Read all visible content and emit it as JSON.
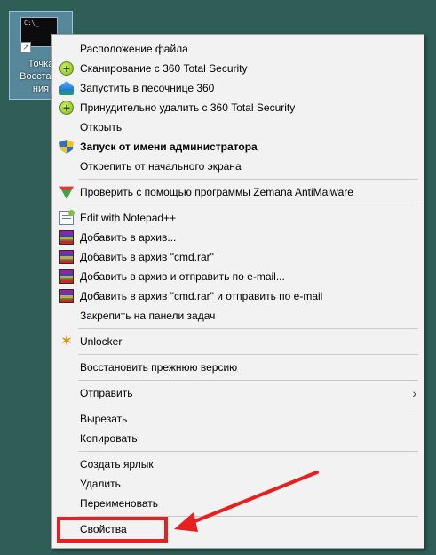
{
  "desktop_icon": {
    "thumb_text": "C:\\_",
    "label_lines": [
      "Точка",
      "Восстано",
      "ния"
    ]
  },
  "menu": {
    "items": [
      {
        "label": "Расположение файла",
        "icon": "none"
      },
      {
        "label": "Сканирование с 360 Total Security",
        "icon": "360-icon"
      },
      {
        "label": "Запустить в песочнице 360",
        "icon": "sandbox-icon"
      },
      {
        "label": "Принудительно удалить с  360 Total Security",
        "icon": "360-icon"
      },
      {
        "label": "Открыть",
        "icon": "none"
      },
      {
        "label": "Запуск от имени администратора",
        "icon": "uac-shield-icon"
      },
      {
        "label": "Открепить от начального экрана",
        "icon": "none"
      },
      {
        "label": "Проверить с помощью программы Zemana AntiMalware",
        "icon": "zemana-icon"
      },
      {
        "label": "Edit with Notepad++",
        "icon": "notepad-icon"
      },
      {
        "label": "Добавить в архив...",
        "icon": "winrar-icon"
      },
      {
        "label": "Добавить в архив \"cmd.rar\"",
        "icon": "winrar-icon"
      },
      {
        "label": "Добавить в архив и отправить по e-mail...",
        "icon": "winrar-icon"
      },
      {
        "label": "Добавить в архив \"cmd.rar\" и отправить по e-mail",
        "icon": "winrar-icon"
      },
      {
        "label": "Закрепить на панели задач",
        "icon": "none"
      },
      {
        "label": "Unlocker",
        "icon": "unlocker-icon"
      },
      {
        "label": "Восстановить прежнюю версию",
        "icon": "none"
      },
      {
        "label": "Отправить",
        "icon": "none"
      },
      {
        "label": "Вырезать",
        "icon": "none"
      },
      {
        "label": "Копировать",
        "icon": "none"
      },
      {
        "label": "Создать ярлык",
        "icon": "none"
      },
      {
        "label": "Удалить",
        "icon": "none"
      },
      {
        "label": "Переименовать",
        "icon": "none"
      },
      {
        "label": "Свойства",
        "icon": "none"
      }
    ],
    "submenu_arrow": "›"
  },
  "annotation": {
    "highlight_color": "#e81f1f"
  }
}
